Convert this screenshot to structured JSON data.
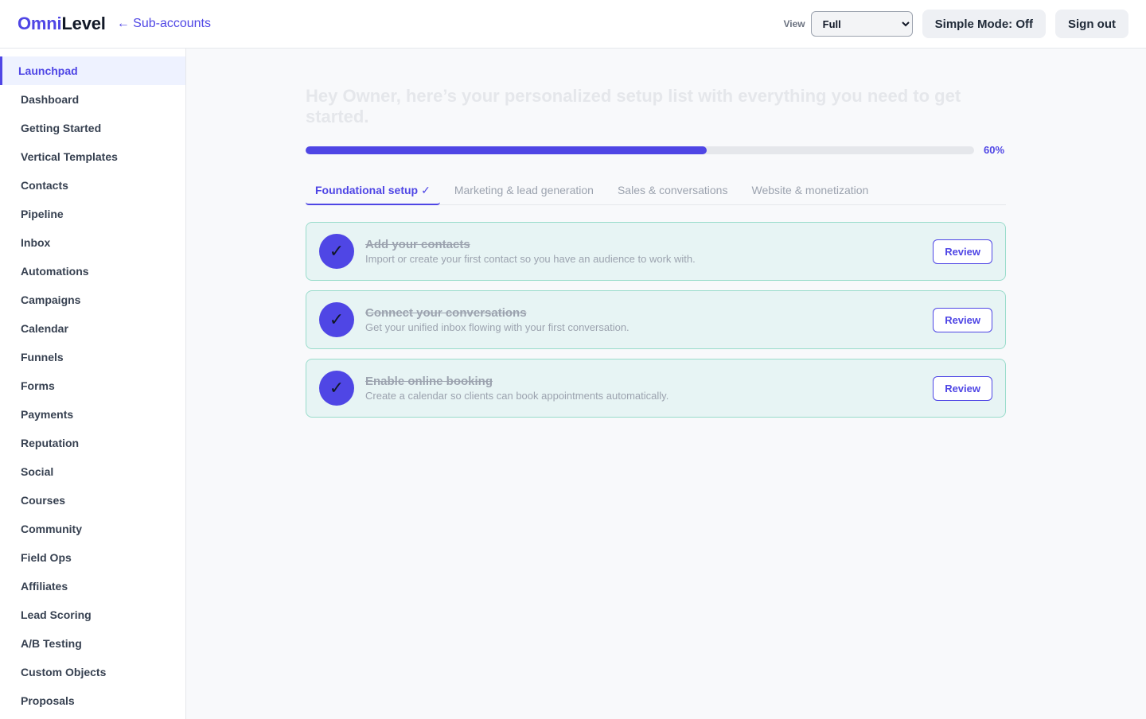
{
  "header": {
    "brand_part1": "Omni",
    "brand_part2": "Level",
    "back_link": "← Sub-accounts",
    "view_label": "View",
    "view_selected": "Full",
    "simple_mode_label": "Simple Mode: Off",
    "sign_out_label": "Sign out"
  },
  "sidebar": {
    "active_index": 0,
    "items": [
      {
        "label": "Launchpad"
      },
      {
        "label": "Dashboard"
      },
      {
        "label": "Getting Started"
      },
      {
        "label": "Vertical Templates"
      },
      {
        "label": "Contacts"
      },
      {
        "label": "Pipeline"
      },
      {
        "label": "Inbox"
      },
      {
        "label": "Automations"
      },
      {
        "label": "Campaigns"
      },
      {
        "label": "Calendar"
      },
      {
        "label": "Funnels"
      },
      {
        "label": "Forms"
      },
      {
        "label": "Payments"
      },
      {
        "label": "Reputation"
      },
      {
        "label": "Social"
      },
      {
        "label": "Courses"
      },
      {
        "label": "Community"
      },
      {
        "label": "Field Ops"
      },
      {
        "label": "Affiliates"
      },
      {
        "label": "Lead Scoring"
      },
      {
        "label": "A/B Testing"
      },
      {
        "label": "Custom Objects"
      },
      {
        "label": "Proposals"
      }
    ]
  },
  "main": {
    "headline": "Hey Owner, here’s your personalized setup list with everything you need to get started.",
    "progress": {
      "value": 60,
      "label": "60%"
    },
    "tabs": [
      {
        "label": "Foundational setup",
        "check": "✓",
        "active": true
      },
      {
        "label": "Marketing & lead generation",
        "check": "",
        "active": false
      },
      {
        "label": "Sales & conversations",
        "check": "",
        "active": false
      },
      {
        "label": "Website & monetization",
        "check": "",
        "active": false
      }
    ],
    "tasks": [
      {
        "title": "Add your contacts",
        "description": "Import or create your first contact so you have an audience to work with.",
        "button": "Review",
        "check": "✓"
      },
      {
        "title": "Connect your conversations",
        "description": "Get your unified inbox flowing with your first conversation.",
        "button": "Review",
        "check": "✓"
      },
      {
        "title": "Enable online booking",
        "description": "Create a calendar so clients can book appointments automatically.",
        "button": "Review",
        "check": "✓"
      }
    ]
  },
  "colors": {
    "accent": "#4f46e5",
    "task_bg": "#e7f4f4",
    "task_border": "#99dccb"
  }
}
